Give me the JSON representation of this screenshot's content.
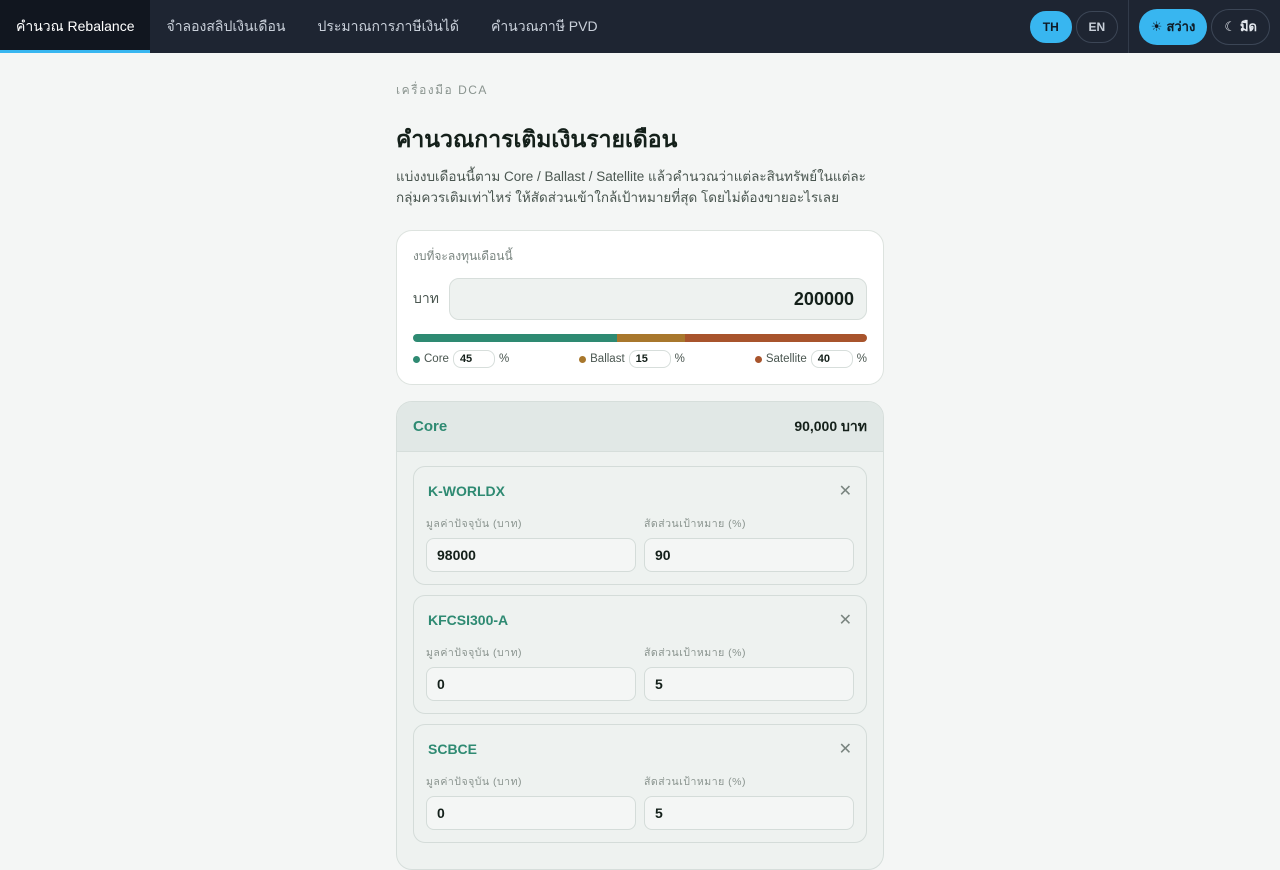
{
  "nav": {
    "tabs": [
      {
        "label": "คำนวณ Rebalance",
        "active": true
      },
      {
        "label": "จำลองสลิปเงินเดือน",
        "active": false
      },
      {
        "label": "ประมาณการภาษีเงินได้",
        "active": false
      },
      {
        "label": "คำนวณภาษี PVD",
        "active": false
      }
    ],
    "lang_th": "TH",
    "lang_en": "EN",
    "theme_light": "สว่าง",
    "theme_dark": "มืด",
    "theme_light_icon": "sun-icon",
    "theme_dark_icon": "moon-icon"
  },
  "page": {
    "eyebrow": "เครื่องมือ DCA",
    "title": "คำนวณการเติมเงินรายเดือน",
    "description": "แบ่งงบเดือนนี้ตาม Core / Ballast / Satellite แล้วคำนวณว่าแต่ละสินทรัพย์ในแต่ละกลุ่มควรเติมเท่าไหร่ ให้สัดส่วนเข้าใกล้เป้าหมายที่สุด โดยไม่ต้องขายอะไรเลย"
  },
  "budget": {
    "label": "งบที่จะลงทุนเดือนนี้",
    "unit": "บาท",
    "value": "200000",
    "allocations": [
      {
        "name": "Core",
        "percent": "45",
        "color": "#2e8a72"
      },
      {
        "name": "Ballast",
        "percent": "15",
        "color": "#a8772c"
      },
      {
        "name": "Satellite",
        "percent": "40",
        "color": "#a8542c"
      }
    ],
    "percent_sign": "%"
  },
  "group": {
    "name": "Core",
    "total": "90,000 บาท",
    "value_label": "มูลค่าปัจจุบัน (บาท)",
    "target_label": "สัดส่วนเป้าหมาย (%)",
    "funds": [
      {
        "name": "K-WORLDX",
        "value": "98000",
        "target": "90"
      },
      {
        "name": "KFCSI300-A",
        "value": "0",
        "target": "5"
      },
      {
        "name": "SCBCE",
        "value": "0",
        "target": "5"
      }
    ]
  }
}
